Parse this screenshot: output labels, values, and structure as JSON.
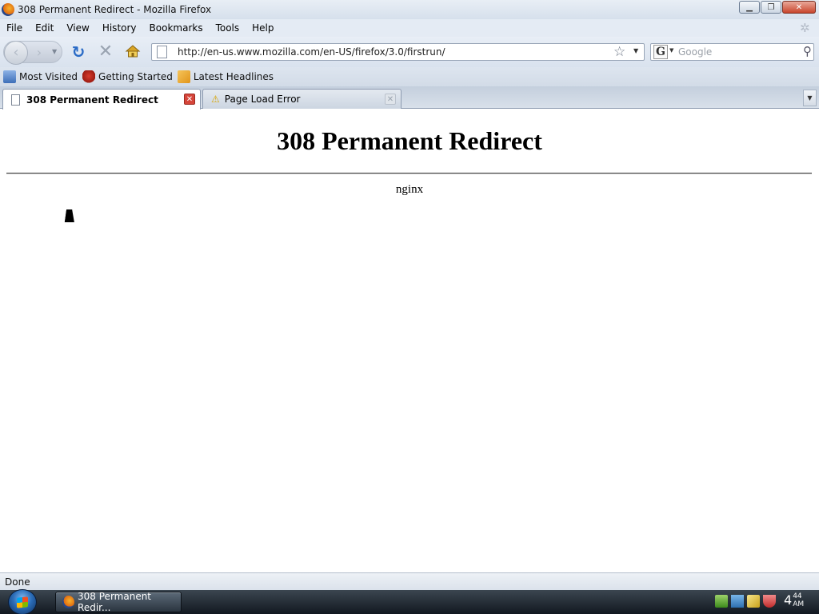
{
  "window": {
    "title": "308 Permanent Redirect - Mozilla Firefox",
    "minimize": "▁",
    "restore": "❐",
    "close": "✕"
  },
  "menu": [
    "File",
    "Edit",
    "View",
    "History",
    "Bookmarks",
    "Tools",
    "Help"
  ],
  "nav": {
    "back_icon": "‹",
    "forward_icon": "›",
    "reload_icon": "↻",
    "stop_icon": "✕",
    "home_icon": "⌂",
    "url": "http://en-us.www.mozilla.com/en-US/firefox/3.0/firstrun/",
    "search_placeholder": "Google",
    "search_engine": "G"
  },
  "bookmarks": [
    "Most Visited",
    "Getting Started",
    "Latest Headlines"
  ],
  "tabs": [
    {
      "label": "308 Permanent Redirect",
      "active": true
    },
    {
      "label": "Page Load Error",
      "active": false
    }
  ],
  "page": {
    "heading": "308 Permanent Redirect",
    "server": "nginx"
  },
  "status": "Done",
  "taskbar": {
    "task_label": "308 Permanent Redir...",
    "clock_hour": "4",
    "clock_minute": "44",
    "clock_ampm": "AM"
  },
  "icons": {
    "firefox": "firefox-logo-icon",
    "warning": "warning-icon",
    "star": "bookmark-star-icon",
    "search": "magnifier-icon"
  }
}
